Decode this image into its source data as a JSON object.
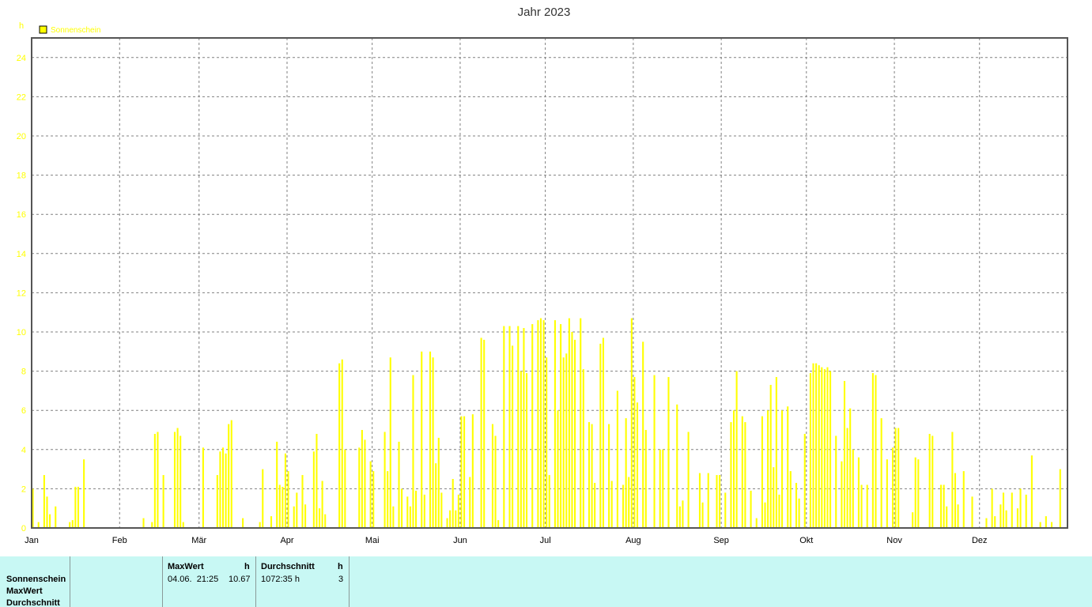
{
  "chart_data": {
    "type": "bar",
    "title": "Jahr 2023",
    "ylabel": "h",
    "xlabel": "",
    "ylim": [
      0,
      25
    ],
    "yticks": [
      0,
      2,
      4,
      6,
      8,
      10,
      12,
      14,
      16,
      18,
      20,
      22,
      24
    ],
    "month_labels": [
      "Jan",
      "Feb",
      "Mär",
      "Apr",
      "Mai",
      "Jun",
      "Jul",
      "Aug",
      "Sep",
      "Okt",
      "Nov",
      "Dez"
    ],
    "month_days": [
      31,
      28,
      31,
      30,
      31,
      30,
      31,
      31,
      30,
      31,
      30,
      31
    ],
    "grid": true,
    "legend_position": "top-left",
    "series": [
      {
        "name": "Sonnenschein",
        "color": "#ffff00",
        "values": [
          2.0,
          0,
          0.3,
          0,
          2.7,
          1.6,
          0.7,
          0,
          1.1,
          0,
          0,
          0,
          0,
          0.3,
          0.4,
          2.1,
          2.1,
          0,
          3.5,
          0,
          0,
          0,
          0,
          0,
          0,
          0,
          0,
          0,
          0,
          0,
          0,
          0,
          0,
          0,
          0,
          0,
          0,
          0,
          0,
          0.5,
          0,
          0,
          0.3,
          4.8,
          4.9,
          0,
          2.7,
          0,
          0,
          0,
          4.9,
          5.1,
          4.7,
          0.3,
          0,
          0,
          0,
          0,
          0,
          0,
          4.1,
          0,
          0,
          0,
          0,
          2.7,
          3.9,
          4.1,
          3.8,
          5.3,
          5.5,
          0,
          0,
          0,
          0.5,
          0,
          0,
          0,
          0,
          0,
          0.3,
          3.0,
          0,
          0,
          0.6,
          0,
          4.4,
          2.2,
          2.1,
          3.8,
          2.9,
          0,
          1.1,
          1.8,
          0,
          2.7,
          1.2,
          0,
          0,
          3.9,
          4.8,
          1.0,
          2.4,
          0.7,
          0,
          0,
          0,
          0,
          8.4,
          8.6,
          4.0,
          0,
          0,
          0,
          0,
          4.1,
          5.0,
          4.5,
          0,
          3.4,
          2.9,
          0,
          0,
          0,
          4.9,
          2.9,
          8.7,
          1.1,
          0,
          4.4,
          2.0,
          0,
          1.6,
          1.1,
          7.8,
          1.9,
          0,
          9.0,
          1.7,
          0,
          9.0,
          8.7,
          3.3,
          4.6,
          1.8,
          0,
          0.5,
          0.9,
          2.5,
          0.9,
          1.7,
          5.7,
          5.7,
          0,
          2.6,
          5.8,
          0,
          0,
          9.7,
          9.6,
          0,
          0,
          5.3,
          4.7,
          0.4,
          0,
          10.3,
          0,
          10.3,
          9.3,
          0,
          10.3,
          8.0,
          10.2,
          7.9,
          0,
          10.4,
          0,
          10.6,
          10.7,
          10.6,
          8.7,
          2.7,
          0,
          10.6,
          6.0,
          10.4,
          8.7,
          8.9,
          10.7,
          10.0,
          9.6,
          0,
          10.7,
          8.1,
          0,
          5.4,
          5.3,
          2.3,
          0,
          9.4,
          9.7,
          0,
          5.3,
          2.4,
          0,
          7.0,
          0,
          2.2,
          5.6,
          2.6,
          10.7,
          7.7,
          6.4,
          0,
          9.5,
          5.0,
          0,
          0,
          7.8,
          0,
          4.0,
          4.0,
          0,
          7.7,
          0,
          0,
          6.3,
          1.1,
          1.4,
          0,
          4.9,
          0,
          0,
          0,
          2.8,
          1.3,
          0,
          2.8,
          0,
          0,
          2.7,
          2.7,
          0,
          1.8,
          0,
          5.4,
          6.0,
          8.0,
          0,
          5.7,
          5.4,
          0,
          1.9,
          0,
          0.5,
          0,
          5.7,
          1.3,
          6.0,
          7.3,
          3.1,
          7.7,
          1.7,
          6.0,
          0,
          6.2,
          2.9,
          0,
          2.3,
          1.5,
          0,
          4.8,
          0,
          7.9,
          8.4,
          8.4,
          8.3,
          8.2,
          8.1,
          8.2,
          8.0,
          0,
          4.7,
          0,
          3.4,
          7.5,
          5.1,
          6.1,
          4.0,
          0,
          3.6,
          2.2,
          0,
          2.2,
          0,
          7.9,
          7.8,
          0,
          5.6,
          0,
          3.5,
          0,
          4.1,
          5.1,
          5.1,
          0,
          0,
          0,
          0,
          0.8,
          3.6,
          3.5,
          0,
          0,
          0,
          4.8,
          4.7,
          0,
          0,
          2.2,
          2.2,
          1.1,
          0,
          4.9,
          2.8,
          1.2,
          0,
          2.9,
          0,
          0,
          1.6,
          0,
          0,
          0,
          0,
          0.5,
          0,
          2.0,
          0.6,
          0,
          1.2,
          1.8,
          0.9,
          0,
          1.8,
          0,
          1.0,
          2.0,
          0,
          1.7,
          0,
          3.7,
          0,
          0,
          0.3,
          0,
          0.6,
          0,
          0.3,
          0,
          0,
          3.0,
          0,
          0,
          0,
          0,
          0,
          0,
          0,
          0,
          0,
          3.4,
          0,
          0,
          2.8,
          0,
          1.5,
          0,
          0,
          4.3,
          0,
          0.4,
          0.4,
          0,
          2.4,
          0.4,
          0,
          0,
          0,
          0.3,
          1.8,
          4.6,
          0,
          0,
          0,
          0,
          0,
          0,
          0,
          0,
          0.6,
          0,
          1.5,
          0,
          0.8,
          0
        ]
      }
    ]
  },
  "stats": {
    "row_labels": [
      "Sonnenschein",
      "MaxWert",
      "Durchschnitt"
    ],
    "max_header": "MaxWert",
    "max_unit": "h",
    "max_datetime": "04.06.  21:25",
    "max_value": "10.67",
    "avg_header": "Durchschnitt",
    "avg_unit": "h",
    "avg_sum": "1072:35 h",
    "avg_value": "3"
  }
}
